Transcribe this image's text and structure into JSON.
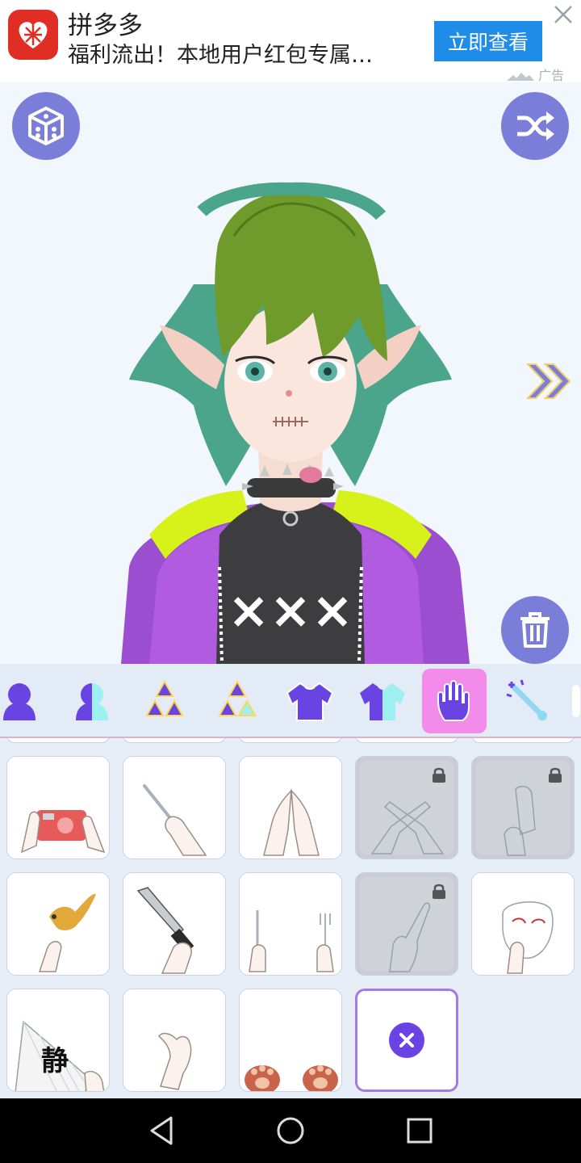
{
  "ad": {
    "title": "拼多多",
    "description": "福利流出！本地用户红包专属…",
    "cta": "立即查看",
    "label": "广告"
  },
  "stage": {
    "left_buttons": [
      "dice-icon"
    ],
    "right_buttons": [
      "shuffle-icon",
      "trash-icon"
    ]
  },
  "toolbar": {
    "tools": [
      {
        "name": "body-silhouette-icon",
        "active": false
      },
      {
        "name": "body-half-color-icon",
        "active": false
      },
      {
        "name": "triangles-solid-icon",
        "active": false
      },
      {
        "name": "triangles-half-icon",
        "active": false
      },
      {
        "name": "shirt-solid-icon",
        "active": false
      },
      {
        "name": "shirt-half-icon",
        "active": false
      },
      {
        "name": "hand-icon",
        "active": true
      },
      {
        "name": "magic-wand-icon",
        "active": false
      }
    ]
  },
  "grid": {
    "items": [
      {
        "name": "hands-camera",
        "locked": false
      },
      {
        "name": "hand-pen",
        "locked": false
      },
      {
        "name": "hands-heart-pose",
        "locked": false
      },
      {
        "name": "hands-crossed",
        "locked": true
      },
      {
        "name": "hands-raised",
        "locked": true
      },
      {
        "name": "hand-bird",
        "locked": false
      },
      {
        "name": "hand-knife",
        "locked": false
      },
      {
        "name": "hands-knife-fork",
        "locked": false
      },
      {
        "name": "hand-pointing",
        "locked": true
      },
      {
        "name": "hand-mask",
        "locked": false
      },
      {
        "name": "hand-fan",
        "locked": false
      },
      {
        "name": "hand-relaxed",
        "locked": false
      },
      {
        "name": "paws",
        "locked": false
      },
      {
        "name": "none",
        "locked": false,
        "selected": true
      }
    ],
    "fan_text": "静"
  },
  "colors": {
    "accent": "#7b7ed8",
    "active_tab": "#f38bea",
    "ad_button": "#1f8de8",
    "remove": "#6a43e3"
  }
}
